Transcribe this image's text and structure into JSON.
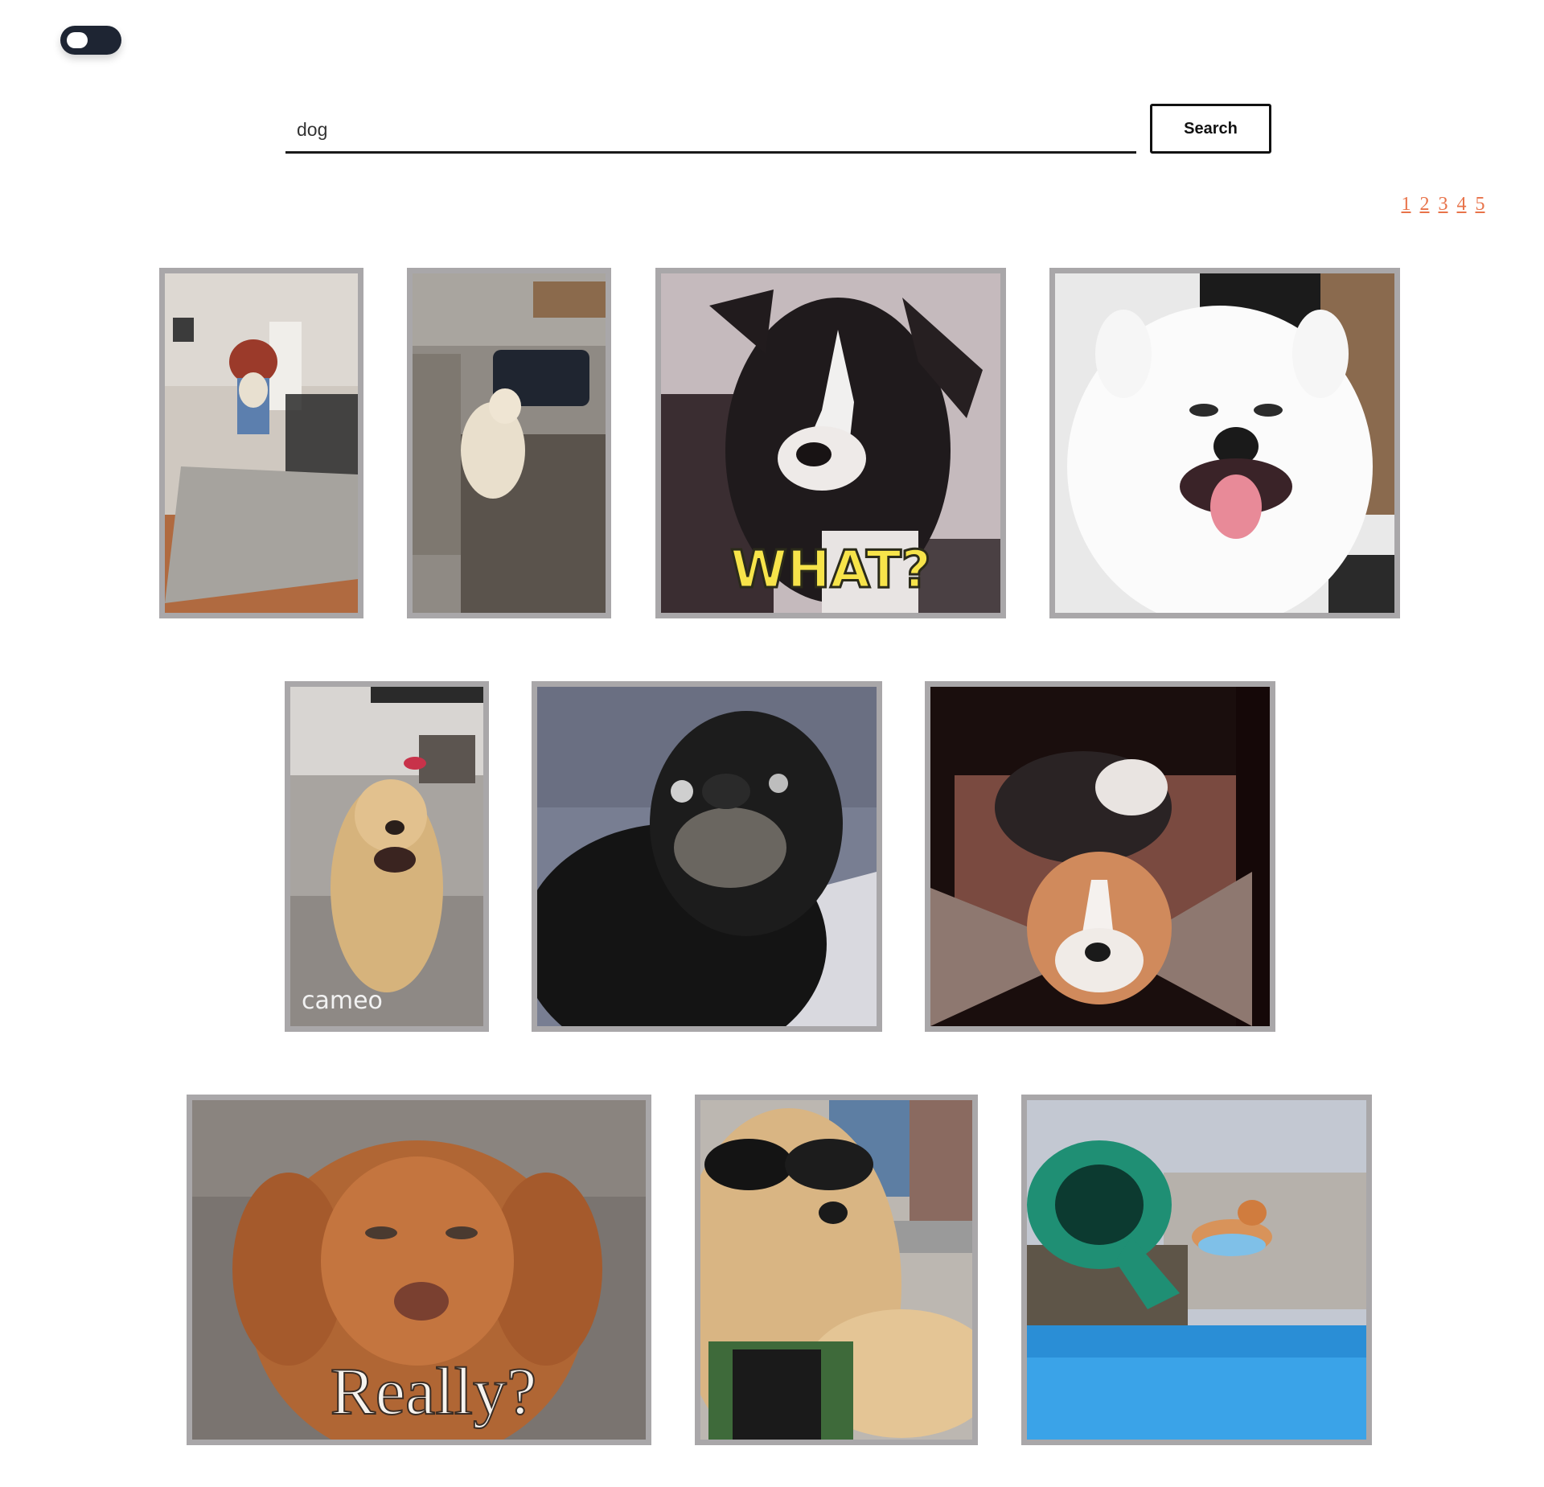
{
  "theme_toggle": {
    "state": "dark"
  },
  "search": {
    "value": "dog",
    "button_label": "Search"
  },
  "pagination": {
    "pages": [
      "1",
      "2",
      "3",
      "4",
      "5"
    ]
  },
  "results": [
    {
      "description": "dog in costume with wig running across living room",
      "overlay_text": ""
    },
    {
      "description": "golden retriever on wooden porch steps looking at black car",
      "overlay_text": ""
    },
    {
      "description": "black and white dog looking confused",
      "overlay_text": "WHAT?"
    },
    {
      "description": "white fluffy samoyed smiling with tongue out",
      "overlay_text": ""
    },
    {
      "description": "golden retriever with lipstick kisses on head",
      "overlay_text": "cameo"
    },
    {
      "description": "black dog with surprised wide eyes",
      "overlay_text": ""
    },
    {
      "description": "beagle puppy resting on couch cushions",
      "overlay_text": ""
    },
    {
      "description": "brown vizsla puppy with skeptical face",
      "overlay_text": "Really?"
    },
    {
      "description": "golden retriever wearing sunglasses in car",
      "overlay_text": ""
    },
    {
      "description": "corgi jumping off water slide into pool",
      "overlay_text": ""
    }
  ]
}
